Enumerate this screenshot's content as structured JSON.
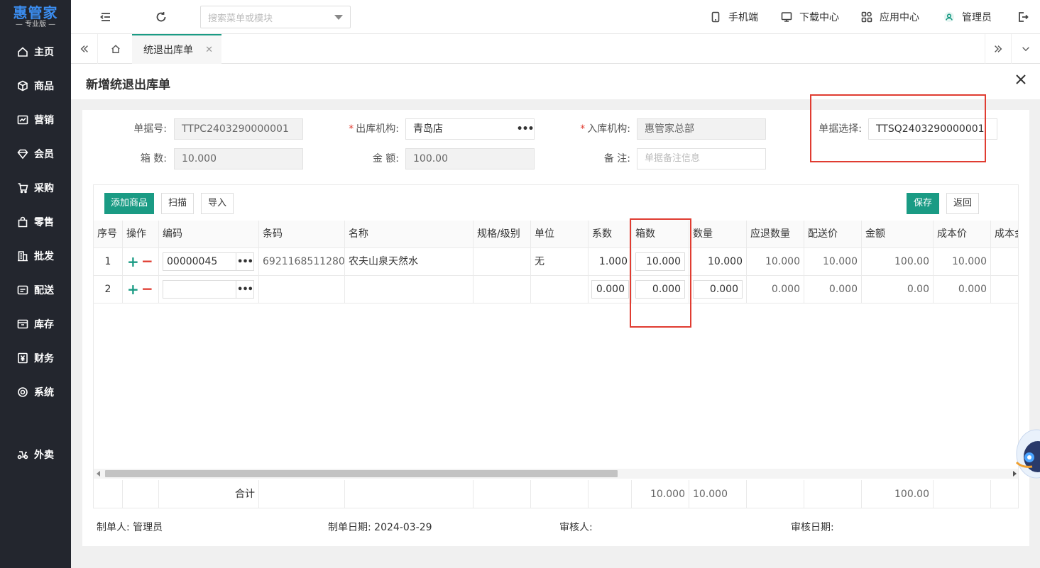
{
  "logo": {
    "main": "惠管家",
    "sub": "— 专业版 —"
  },
  "sidebar": {
    "items": [
      {
        "label": "主页",
        "icon": "home-icon"
      },
      {
        "label": "商品",
        "icon": "box-icon"
      },
      {
        "label": "营销",
        "icon": "chart-icon"
      },
      {
        "label": "会员",
        "icon": "diamond-icon"
      },
      {
        "label": "采购",
        "icon": "cart-icon"
      },
      {
        "label": "零售",
        "icon": "bag-icon"
      },
      {
        "label": "批发",
        "icon": "building-icon"
      },
      {
        "label": "配送",
        "icon": "truck-icon"
      },
      {
        "label": "库存",
        "icon": "warehouse-icon"
      },
      {
        "label": "财务",
        "icon": "yen-icon"
      },
      {
        "label": "系统",
        "icon": "gear-icon"
      },
      {
        "label": "外卖",
        "icon": "scooter-icon"
      }
    ]
  },
  "header": {
    "search_placeholder": "搜索菜单或模块",
    "links": {
      "mobile": "手机端",
      "download": "下载中心",
      "apps": "应用中心",
      "user": "管理员"
    }
  },
  "tabs": {
    "active": "统退出库单"
  },
  "dialog": {
    "title": "新增统退出库单",
    "form": {
      "doc_no_label": "单据号:",
      "doc_no": "TTPC2403290000001",
      "out_org_label": "出库机构:",
      "out_org": "青岛店",
      "in_org_label": "入库机构:",
      "in_org": "惠管家总部",
      "doc_select_label": "单据选择:",
      "doc_select": "TTSQ2403290000001",
      "boxes_label": "箱 数:",
      "boxes": "10.000",
      "amount_label": "金 额:",
      "amount": "100.00",
      "remark_label": "备 注:",
      "remark_placeholder": "单据备注信息"
    },
    "toolbar": {
      "add": "添加商品",
      "scan": "扫描",
      "import": "导入",
      "save": "保存",
      "back": "返回"
    },
    "columns": [
      "序号",
      "操作",
      "编码",
      "条码",
      "名称",
      "规格/级别",
      "单位",
      "系数",
      "箱数",
      "数量",
      "应退数量",
      "配送价",
      "金额",
      "成本价",
      "成本金"
    ],
    "rows": [
      {
        "no": "1",
        "code": "00000045",
        "barcode": "6921168511280",
        "name": "农夫山泉天然水",
        "spec": "",
        "unit": "无",
        "coef": "1.000",
        "boxes": "10.000",
        "qty": "10.000",
        "due_qty": "10.000",
        "price": "10.000",
        "amount": "100.00",
        "cost": "10.000"
      },
      {
        "no": "2",
        "code": "",
        "barcode": "",
        "name": "",
        "spec": "",
        "unit": "",
        "coef": "0.000",
        "boxes": "0.000",
        "qty": "0.000",
        "due_qty": "0.000",
        "price": "0.000",
        "amount": "0.00",
        "cost": "0.000"
      }
    ],
    "totals": {
      "label": "合计",
      "boxes": "10.000",
      "qty": "10.000",
      "amount": "100.00"
    },
    "meta": {
      "creator_label": "制单人:",
      "creator": "管理员",
      "created_label": "制单日期:",
      "created": "2024-03-29",
      "auditor_label": "审核人:",
      "auditor": "",
      "audit_date_label": "审核日期:",
      "audit_date": ""
    }
  },
  "colors": {
    "accent": "#1a9b84",
    "highlight": "#e03c31",
    "sidebar_bg": "#23262e"
  }
}
